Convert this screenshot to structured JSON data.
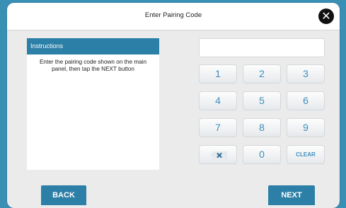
{
  "dialog": {
    "title": "Enter Pairing Code",
    "close_icon_glyph": "✕"
  },
  "instructions": {
    "header": "Instructions",
    "text": "Enter the pairing code shown on the main panel, then tap the NEXT button"
  },
  "code_input": {
    "value": "",
    "placeholder": ""
  },
  "keypad": {
    "keys": [
      "1",
      "2",
      "3",
      "4",
      "5",
      "6",
      "7",
      "8",
      "9"
    ],
    "zero": "0",
    "clear": "CLEAR",
    "backspace_icon": "backspace-icon"
  },
  "footer": {
    "back": "BACK",
    "next": "NEXT"
  },
  "colors": {
    "accent": "#2c7fa6",
    "key_text": "#3d8fbc",
    "page_background": "#3a8fb4"
  }
}
